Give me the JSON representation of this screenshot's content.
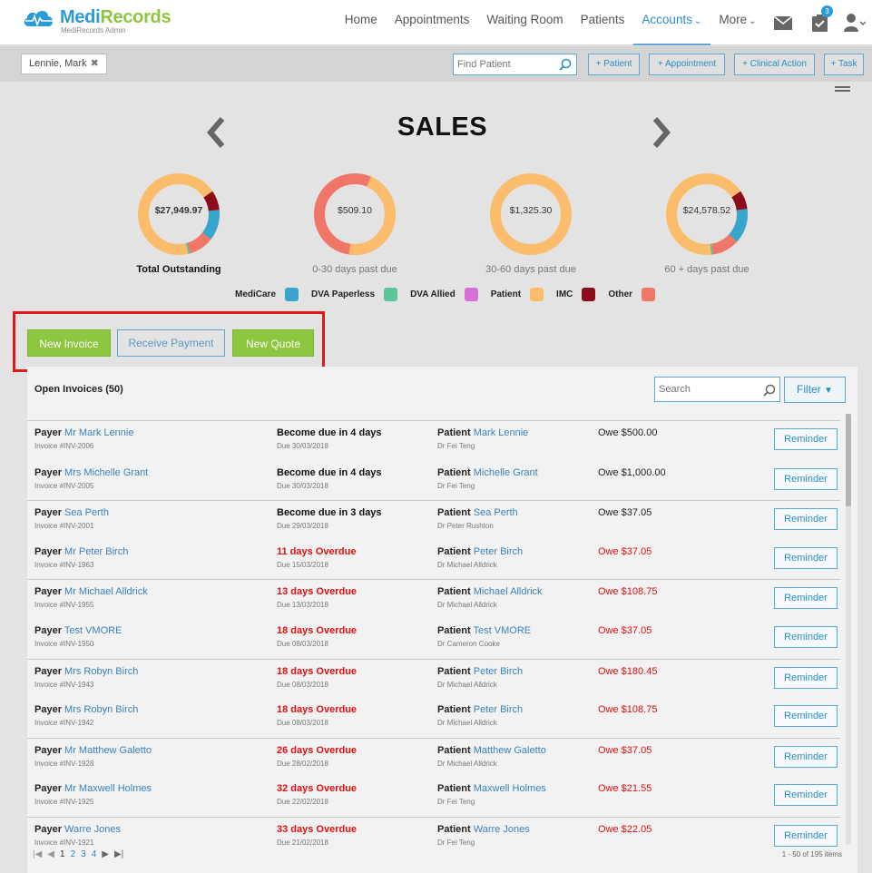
{
  "brand": {
    "name_part1": "Medi",
    "name_part2": "Records",
    "subtitle": "MediRecords Admin"
  },
  "nav": {
    "items": [
      "Home",
      "Appointments",
      "Waiting Room",
      "Patients",
      "Accounts",
      "More"
    ],
    "active": "Accounts",
    "tasks_badge": "3"
  },
  "subbar": {
    "patient_tag": "Lennie, Mark",
    "find_patient_placeholder": "Find Patient",
    "buttons": [
      "+ Patient",
      "+ Appointment",
      "+ Clinical Action",
      "+ Task"
    ]
  },
  "sales": {
    "title": "SALES",
    "donuts": [
      {
        "value": "$27,949.97",
        "label": "Total Outstanding"
      },
      {
        "value": "$509.10",
        "label": "0-30 days past due"
      },
      {
        "value": "$1,325.30",
        "label": "30-60 days past due"
      },
      {
        "value": "$24,578.52",
        "label": "60 + days past due"
      }
    ]
  },
  "legend": [
    {
      "label": "MediCare",
      "color": "#3aa5cc"
    },
    {
      "label": "DVA Paperless",
      "color": "#5cc49a"
    },
    {
      "label": "DVA Allied",
      "color": "#d76fd6"
    },
    {
      "label": "Patient",
      "color": "#fbbd6b"
    },
    {
      "label": "IMC",
      "color": "#8b0d1b"
    },
    {
      "label": "Other",
      "color": "#f0766a"
    }
  ],
  "actions": {
    "new_invoice": "New Invoice",
    "receive_payment": "Receive Payment",
    "new_quote": "New Quote"
  },
  "invoices": {
    "title": "Open Invoices (50)",
    "search_placeholder": "Search",
    "filter_label": "Filter",
    "payer_label": "Payer",
    "patient_label": "Patient",
    "reminder_label": "Reminder",
    "rows": [
      {
        "payer": "Mr Mark Lennie",
        "invoice": "Invoice #INV-2006",
        "status": "Become due in 4 days",
        "due": "Due 30/03/2018",
        "patient": "Mark Lennie",
        "doctor": "Dr Fei Teng",
        "owe": "Owe $500.00",
        "overdue": false
      },
      {
        "payer": "Mrs Michelle Grant",
        "invoice": "Invoice #INV-2005",
        "status": "Become due in 4 days",
        "due": "Due 30/03/2018",
        "patient": "Michelle Grant",
        "doctor": "Dr Fei Teng",
        "owe": "Owe $1,000.00",
        "overdue": false
      },
      {
        "payer": "Sea Perth",
        "invoice": "Invoice #INV-2001",
        "status": "Become due in 3 days",
        "due": "Due 29/03/2018",
        "patient": "Sea Perth",
        "doctor": "Dr Peter Rushton",
        "owe": "Owe $37.05",
        "overdue": false
      },
      {
        "payer": "Mr Peter Birch",
        "invoice": "Invoice #INV-1963",
        "status": "11 days Overdue",
        "due": "Due 15/03/2018",
        "patient": "Peter Birch",
        "doctor": "Dr Michael Alldrick",
        "owe": "Owe $37.05",
        "overdue": true
      },
      {
        "payer": "Mr Michael Alldrick",
        "invoice": "Invoice #INV-1955",
        "status": "13 days Overdue",
        "due": "Due 13/03/2018",
        "patient": "Michael Alldrick",
        "doctor": "Dr Michael Alldrick",
        "owe": "Owe $108.75",
        "overdue": true
      },
      {
        "payer": "Test VMORE",
        "invoice": "Invoice #INV-1950",
        "status": "18 days Overdue",
        "due": "Due 08/03/2018",
        "patient": "Test VMORE",
        "doctor": "Dr Cameron Cooke",
        "owe": "Owe $37.05",
        "overdue": true
      },
      {
        "payer": "Mrs Robyn Birch",
        "invoice": "Invoice #INV-1943",
        "status": "18 days Overdue",
        "due": "Due 08/03/2018",
        "patient": "Peter Birch",
        "doctor": "Dr Michael Alldrick",
        "owe": "Owe $180.45",
        "overdue": true
      },
      {
        "payer": "Mrs Robyn Birch",
        "invoice": "Invoice #INV-1942",
        "status": "18 days Overdue",
        "due": "Due 08/03/2018",
        "patient": "Peter Birch",
        "doctor": "Dr Michael Alldrick",
        "owe": "Owe $108.75",
        "overdue": true
      },
      {
        "payer": "Mr Matthew Galetto",
        "invoice": "Invoice #INV-1928",
        "status": "26 days Overdue",
        "due": "Due 28/02/2018",
        "patient": "Matthew Galetto",
        "doctor": "Dr Michael Alldrick",
        "owe": "Owe $37.05",
        "overdue": true
      },
      {
        "payer": "Mr Maxwell Holmes",
        "invoice": "Invoice #INV-1925",
        "status": "32 days Overdue",
        "due": "Due 22/02/2018",
        "patient": "Maxwell Holmes",
        "doctor": "Dr Fei Teng",
        "owe": "Owe $21.55",
        "overdue": true
      },
      {
        "payer": "Warre Jones",
        "invoice": "Invoice #INV-1921",
        "status": "33 days Overdue",
        "due": "Due 21/02/2018",
        "patient": "Warre Jones",
        "doctor": "Dr Fei Teng",
        "owe": "Owe $22.05",
        "overdue": true
      }
    ]
  },
  "pagination": {
    "pages": [
      "1",
      "2",
      "3",
      "4"
    ],
    "summary": "1 - 50 of 195 items"
  }
}
